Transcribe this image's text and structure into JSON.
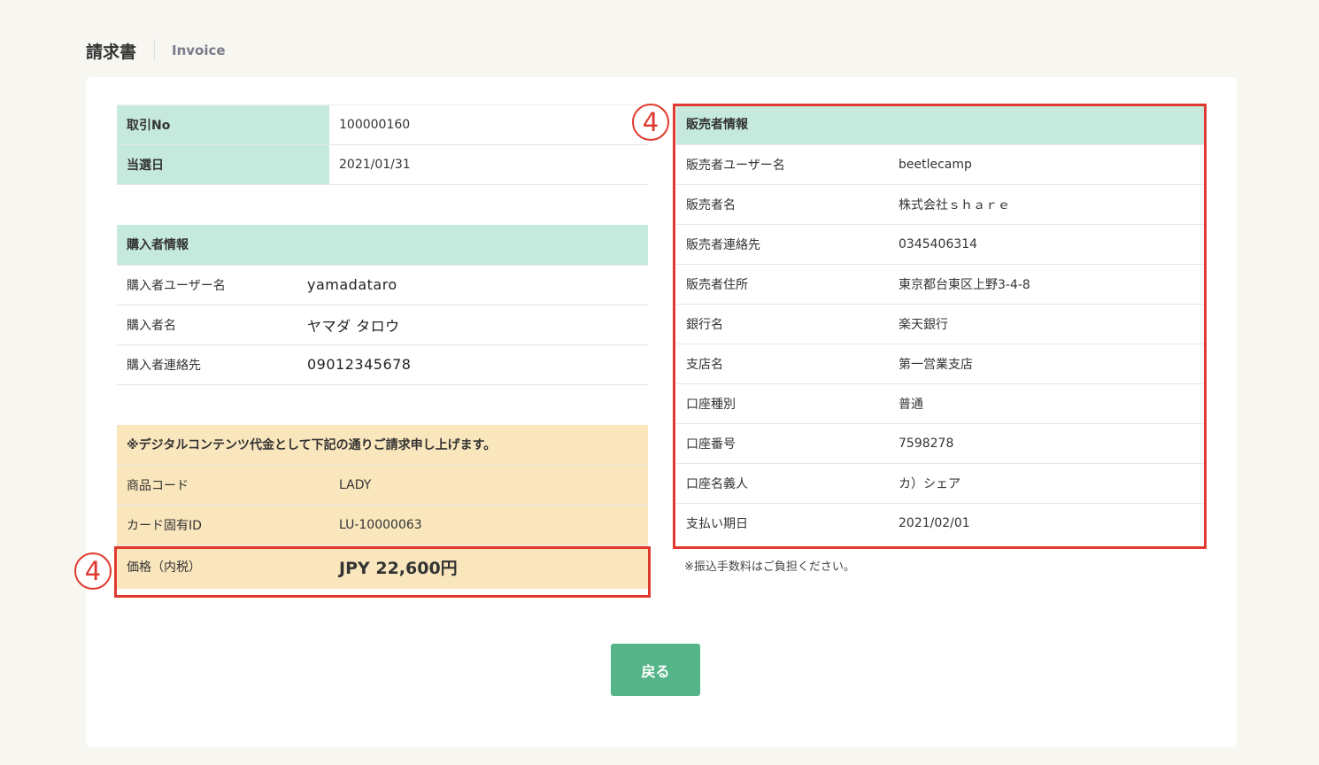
{
  "header": {
    "title": "請求書",
    "subtitle": "Invoice"
  },
  "deal": [
    {
      "label": "取引No",
      "value": "100000160"
    },
    {
      "label": "当選日",
      "value": "2021/01/31"
    }
  ],
  "buyer": {
    "heading": "購入者情報",
    "rows": [
      {
        "label": "購入者ユーザー名",
        "value": "yamadataro"
      },
      {
        "label": "購入者名",
        "value": "ヤマダ タロウ"
      },
      {
        "label": "購入者連絡先",
        "value": "09012345678"
      }
    ]
  },
  "content": {
    "heading": "※デジタルコンテンツ代金として下記の通りご請求申し上げます。",
    "rows": [
      {
        "label": "商品コード",
        "value": "LADY"
      },
      {
        "label": "カード固有ID",
        "value": "LU-10000063"
      }
    ],
    "price": {
      "label": "価格（内税）",
      "value": "JPY 22,600円"
    }
  },
  "seller": {
    "heading": "販売者情報",
    "rows": [
      {
        "label": "販売者ユーザー名",
        "value": "beetlecamp"
      },
      {
        "label": "販売者名",
        "value": "株式会社ｓｈａｒｅ"
      },
      {
        "label": "販売者連絡先",
        "value": "0345406314"
      },
      {
        "label": "販売者住所",
        "value": "東京都台東区上野3-4-8"
      },
      {
        "label": "銀行名",
        "value": "楽天銀行"
      },
      {
        "label": "支店名",
        "value": "第一営業支店"
      },
      {
        "label": "口座種別",
        "value": "普通"
      },
      {
        "label": "口座番号",
        "value": "7598278"
      },
      {
        "label": "口座名義人",
        "value": "カ）シェア"
      },
      {
        "label": "支払い期日",
        "value": "2021/02/01"
      }
    ],
    "note": "※振込手数料はご負担ください。"
  },
  "annotations": {
    "seller_marker": "4",
    "price_marker": "4",
    "color": "#e0392f"
  },
  "buttons": {
    "back_label": "戻る"
  },
  "colors": {
    "accent_green": "#55b589",
    "header_green": "#c5e9dc",
    "content_orange": "#fae6bd"
  }
}
